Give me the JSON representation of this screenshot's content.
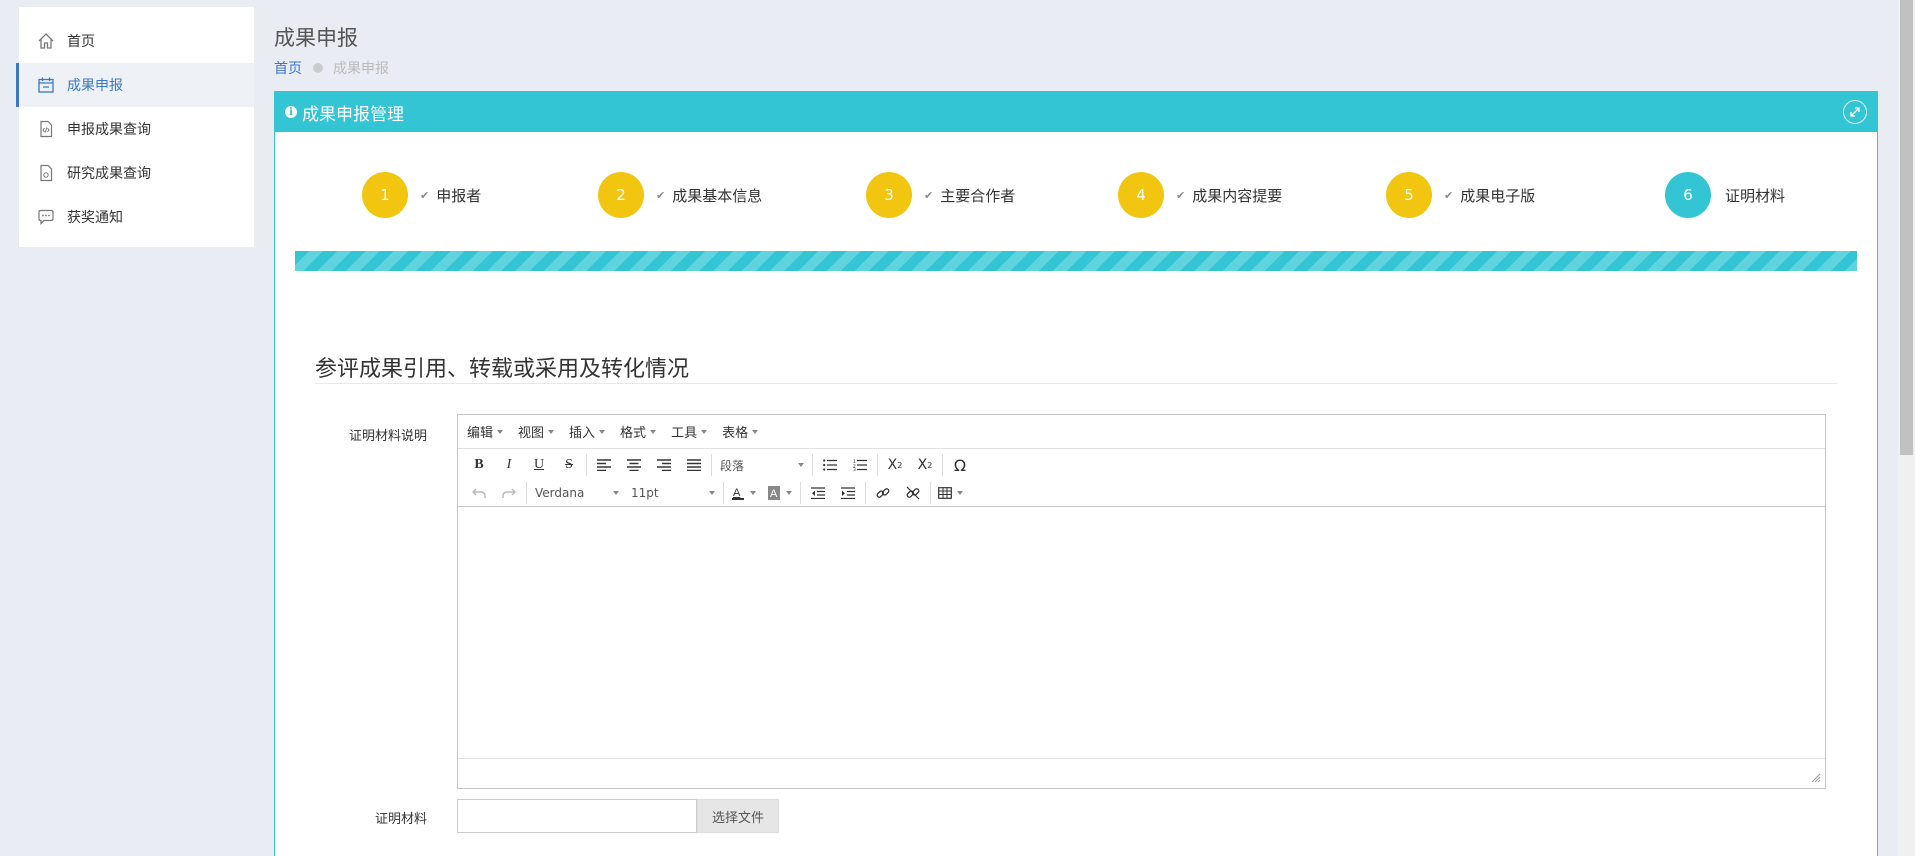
{
  "sidebar": {
    "items": [
      {
        "label": "首页",
        "icon": "home-icon"
      },
      {
        "label": "成果申报",
        "icon": "calendar-icon",
        "active": true
      },
      {
        "label": "申报成果查询",
        "icon": "code-file-icon"
      },
      {
        "label": "研究成果查询",
        "icon": "document-icon"
      },
      {
        "label": "获奖通知",
        "icon": "chat-bubble-icon"
      }
    ]
  },
  "header": {
    "title": "成果申报",
    "breadcrumb": {
      "home": "首页",
      "current": "成果申报"
    }
  },
  "panel": {
    "title": "成果申报管理",
    "expand_icon": "expand-icon",
    "accent_color": "#34c5d4"
  },
  "steps": [
    {
      "number": "1",
      "label": "申报者",
      "done": true
    },
    {
      "number": "2",
      "label": "成果基本信息",
      "done": true
    },
    {
      "number": "3",
      "label": "主要合作者",
      "done": true
    },
    {
      "number": "4",
      "label": "成果内容提要",
      "done": true
    },
    {
      "number": "5",
      "label": "成果电子版",
      "done": true
    },
    {
      "number": "6",
      "label": "证明材料",
      "done": false,
      "current": true
    }
  ],
  "progress_percent": 100,
  "section": {
    "title": "参评成果引用、转载或采用及转化情况"
  },
  "form": {
    "description_label": "证明材料说明",
    "file_label": "证明材料",
    "file_button": "选择文件"
  },
  "editor": {
    "menus": [
      "编辑",
      "视图",
      "插入",
      "格式",
      "工具",
      "表格"
    ],
    "block_format": "段落",
    "font_family": "Verdana",
    "font_size": "11pt"
  },
  "colors": {
    "step_done": "#f2c511",
    "step_current": "#34c5d4",
    "link": "#3a78c3"
  }
}
